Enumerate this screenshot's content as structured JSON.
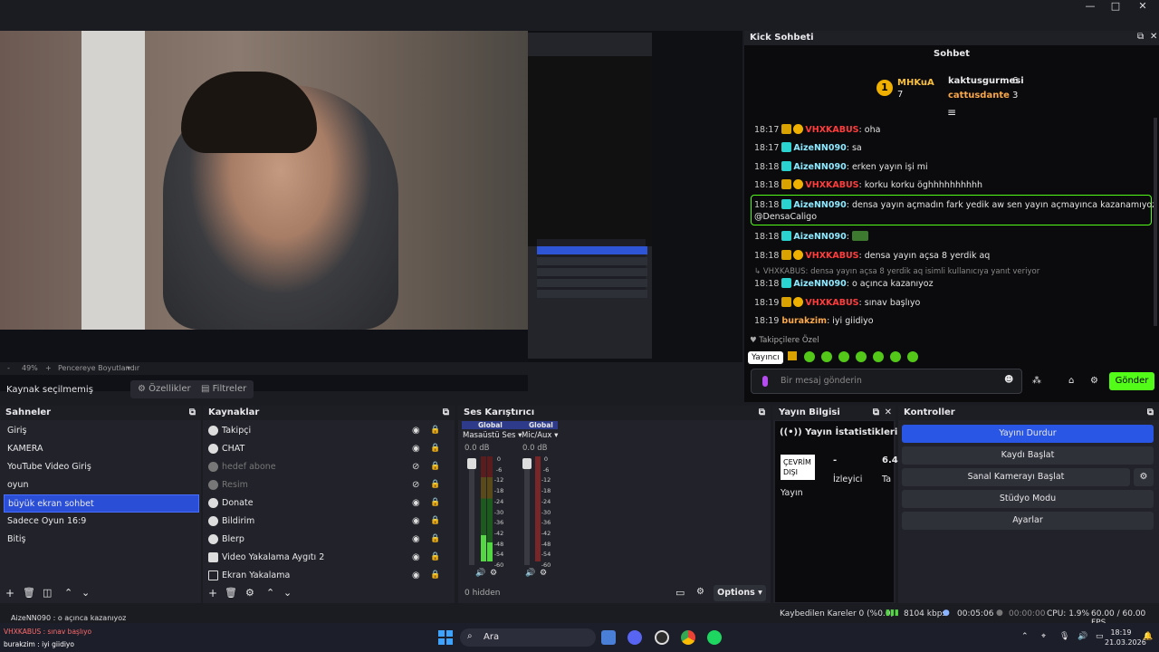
{
  "window": {
    "minimize": "—",
    "maximize": "□",
    "close": "✕"
  },
  "preview": {
    "zoom": "49%",
    "zoom_plus": "+",
    "fit_label": "Pencereye Boyutlandır"
  },
  "source_bar": {
    "no_source": "Kaynak seçilmemiş",
    "properties": "Özellikler",
    "filters": "Filtreler"
  },
  "chat": {
    "panel_title": "Kick Sohbeti",
    "title": "Sohbet",
    "leaderboard": {
      "first": {
        "name": "MHKuA",
        "count": "7"
      },
      "second": {
        "name": "kaktusgurmesi",
        "count": "6"
      },
      "third": {
        "name": "cattusdante",
        "count": "3"
      }
    },
    "messages": [
      {
        "time": "18:17",
        "user": "VHXKABUS",
        "text": ": oha"
      },
      {
        "time": "18:17",
        "user": "AizeNN090",
        "text": ": sa"
      },
      {
        "time": "18:18",
        "user": "AizeNN090",
        "text": ": erken yayın işi mi"
      },
      {
        "time": "18:18",
        "user": "VHXKABUS",
        "text": ": korku korku öghhhhhhhhhh"
      },
      {
        "time": "18:18",
        "user": "AizeNN090",
        "text": ": densa yayın açmadın fark yedik aw sen yayın açmayınca kazanamıyoz",
        "text2": "@DensaCaligo"
      },
      {
        "time": "18:18",
        "user": "AizeNN090",
        "text": ":"
      },
      {
        "time": "18:18",
        "user": "VHXKABUS",
        "text": ": densa yayın açsa 8 yerdik aq"
      },
      {
        "reply": "VHXKABUS: densa yayın açsa 8 yerdik aq isimli kullanıcıya yanıt veriyor"
      },
      {
        "time": "18:18",
        "user": "AizeNN090",
        "text": ": o açınca kazanıyoz"
      },
      {
        "time": "18:19",
        "user": "VHXKABUS",
        "text": ": sınav başlıyo"
      },
      {
        "time": "18:19",
        "user": "burakzim",
        "text": ": iyi giidiyo"
      }
    ],
    "followers_only": "Takipçilere Özel",
    "tooltip": "Yayıncı",
    "input_placeholder": "Bir mesaj gönderin",
    "send": "Gönder"
  },
  "scenes": {
    "title": "Sahneler",
    "items": [
      "Giriş",
      "KAMERA",
      "YouTube Video Giriş",
      "oyun",
      "büyük ekran sohbet",
      "Sadece Oyun 16:9",
      "Bitiş"
    ],
    "selected_index": 4
  },
  "sources": {
    "title": "Kaynaklar",
    "items": [
      {
        "label": "Takipçi",
        "visible": true
      },
      {
        "label": "CHAT",
        "visible": true
      },
      {
        "label": "hedef abone",
        "visible": false
      },
      {
        "label": "Resim",
        "visible": false
      },
      {
        "label": "Donate",
        "visible": true
      },
      {
        "label": "Bildirim",
        "visible": true
      },
      {
        "label": "Blerp",
        "visible": true
      },
      {
        "label": "Video Yakalama Aygıtı 2",
        "visible": true
      },
      {
        "label": "Ekran Yakalama",
        "visible": true
      }
    ]
  },
  "mixer": {
    "title": "Ses Karıştırıcı",
    "channels": [
      {
        "tag": "Global",
        "name": "Masaüstü Ses",
        "level": "0.0 dB"
      },
      {
        "tag": "Global",
        "name": "Mic/Aux",
        "level": "0.0 dB"
      }
    ],
    "scale": [
      "0",
      "-6",
      "-12",
      "-18",
      "-24",
      "-30",
      "-36",
      "-42",
      "-48",
      "-54",
      "-60"
    ],
    "hidden": "0 hidden",
    "options": "Options"
  },
  "stream_info": {
    "title": "Yayın Bilgisi",
    "stats_title": "Yayın İstatistikleri",
    "offline": "ÇEVRİM DIŞI",
    "dash": "-",
    "viewers": "İzleyici",
    "partial_value": "6.4",
    "partial_label": "Ta",
    "stream": "Yayın"
  },
  "controls": {
    "title": "Kontroller",
    "buttons": [
      "Yayını Durdur",
      "Kaydı Başlat",
      "Sanal Kamerayı Başlat",
      "Stüdyo Modu",
      "Ayarlar"
    ]
  },
  "status": {
    "dropped": "Kaybedilen Kareler 0 (%0.0)",
    "bitrate": "8104 kbps",
    "live_time": "00:05:06",
    "rec_time": "00:00:00",
    "cpu": "CPU: 1.9%",
    "fps": "60.00 / 60.00 FPS",
    "overlay_line1": "AizeNN090 : o açınca kazanıyoz",
    "overlay_line2": "VHXKABUS : sınav başlıyo",
    "overlay_line3": "burakzim : iyi giidiyo"
  },
  "taskbar": {
    "search": "Ara",
    "time": "18:19",
    "date": "21.03.2026"
  }
}
